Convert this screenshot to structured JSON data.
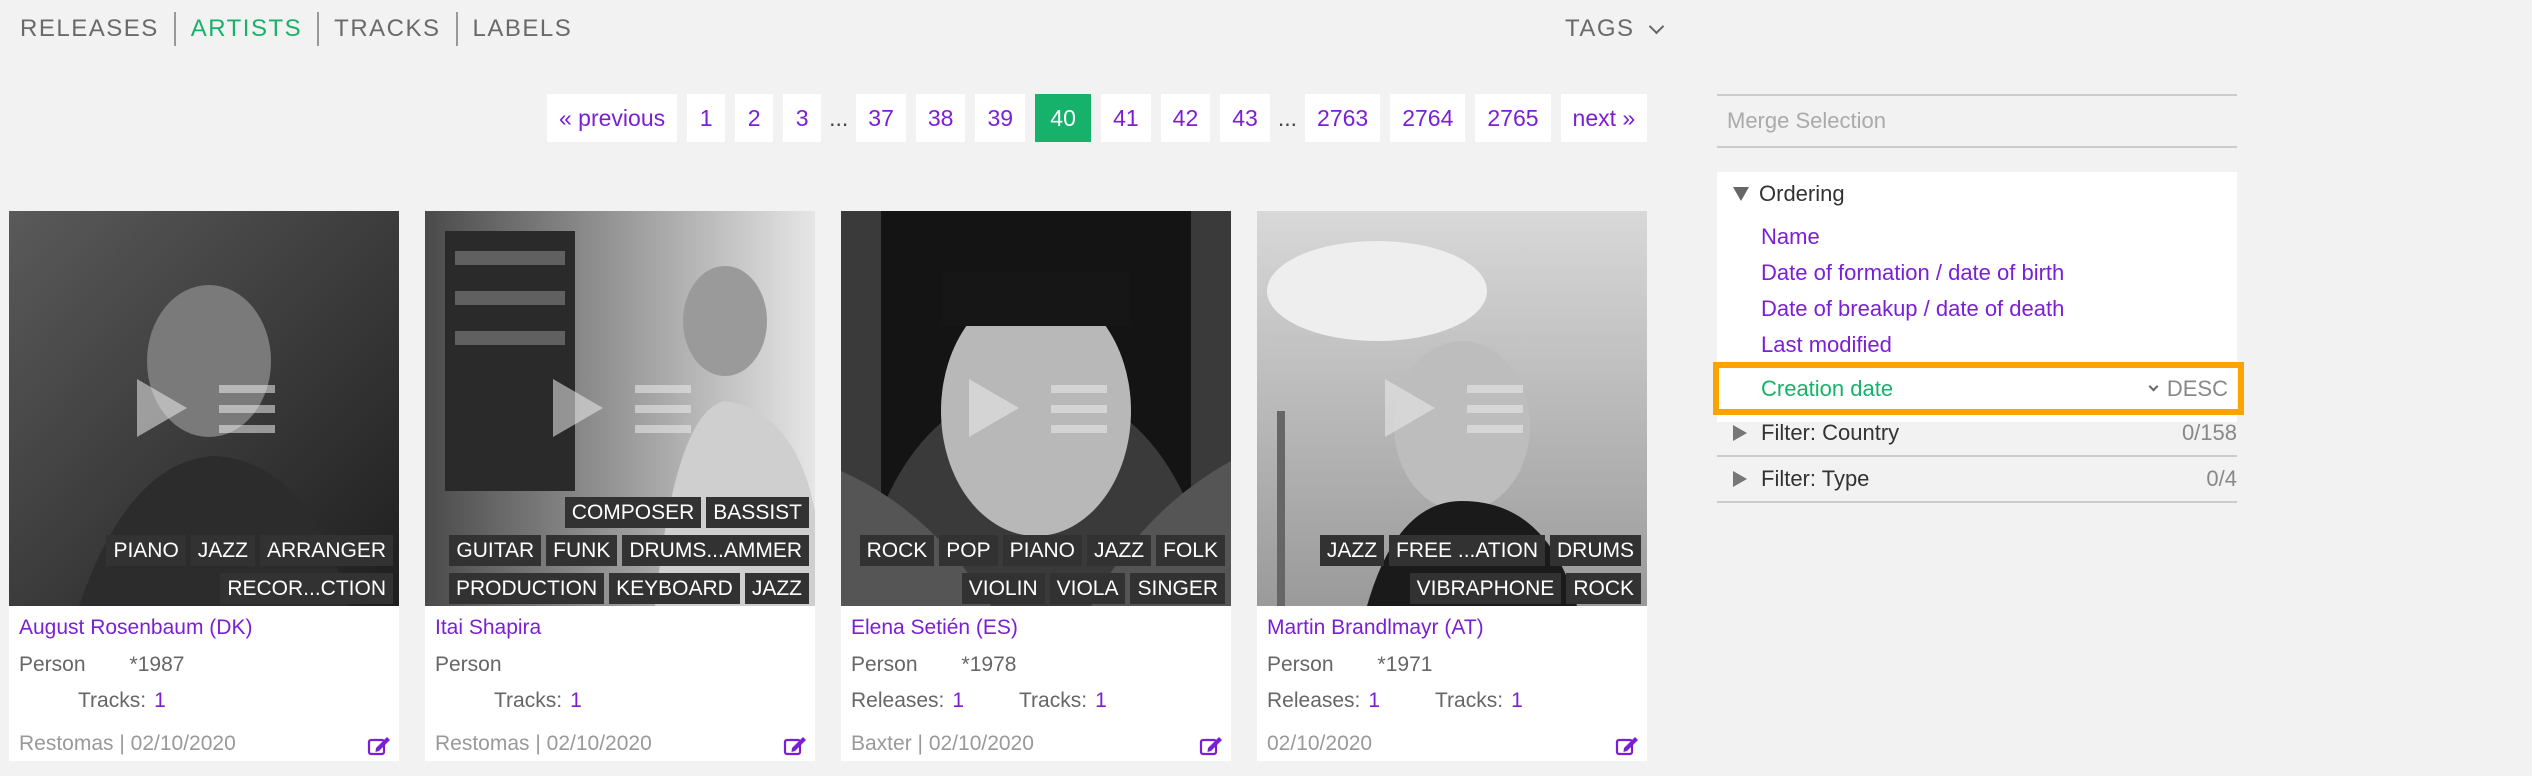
{
  "nav": {
    "tabs": [
      {
        "label": "RELEASES",
        "active": false
      },
      {
        "label": "ARTISTS",
        "active": true
      },
      {
        "label": "TRACKS",
        "active": false
      },
      {
        "label": "LABELS",
        "active": false
      }
    ],
    "tags_label": "TAGS"
  },
  "pagination": {
    "previous": "« previous",
    "next": "next »",
    "pages": [
      "1",
      "2",
      "3",
      "...",
      "37",
      "38",
      "39",
      "40",
      "41",
      "42",
      "43",
      "...",
      "2763",
      "2764",
      "2765"
    ],
    "current": "40"
  },
  "artists": [
    {
      "name": "August Rosenbaum (DK)",
      "type": "Person",
      "born": "*1987",
      "releases_label": "",
      "releases": "",
      "tracks_label": "Tracks:",
      "tracks": "1",
      "footer": "Restomas | 02/10/2020",
      "tag_rows": [
        [
          "PIANO",
          "JAZZ",
          "ARRANGER"
        ],
        [
          "RECOR...CTION"
        ]
      ]
    },
    {
      "name": "Itai Shapira",
      "type": "Person",
      "born": "",
      "releases_label": "",
      "releases": "",
      "tracks_label": "Tracks:",
      "tracks": "1",
      "footer": "Restomas | 02/10/2020",
      "tag_rows": [
        [
          "COMPOSER",
          "BASSIST"
        ],
        [
          "GUITAR",
          "FUNK",
          "DRUMS...AMMER"
        ],
        [
          "PRODUCTION",
          "KEYBOARD",
          "JAZZ"
        ]
      ]
    },
    {
      "name": "Elena Setién (ES)",
      "type": "Person",
      "born": "*1978",
      "releases_label": "Releases:",
      "releases": "1",
      "tracks_label": "Tracks:",
      "tracks": "1",
      "footer": "Baxter | 02/10/2020",
      "tag_rows": [
        [
          "ROCK",
          "POP",
          "PIANO",
          "JAZZ",
          "FOLK"
        ],
        [
          "VIOLIN",
          "VIOLA",
          "SINGER"
        ]
      ]
    },
    {
      "name": "Martin Brandlmayr (AT)",
      "type": "Person",
      "born": "*1971",
      "releases_label": "Releases:",
      "releases": "1",
      "tracks_label": "Tracks:",
      "tracks": "1",
      "footer": "02/10/2020",
      "tag_rows": [
        [
          "JAZZ",
          "FREE ...ATION",
          "DRUMS"
        ],
        [
          "VIBRAPHONE",
          "ROCK"
        ]
      ]
    }
  ],
  "sidebar": {
    "merge_placeholder": "Merge Selection",
    "ordering": {
      "title": "Ordering",
      "options": [
        "Name",
        "Date of formation / date of birth",
        "Date of breakup / date of death",
        "Last modified"
      ],
      "selected": "Creation date",
      "direction": "DESC"
    },
    "filters": [
      {
        "label": "Filter: Country",
        "count": "0/158"
      },
      {
        "label": "Filter: Type",
        "count": "0/4"
      }
    ]
  },
  "colors": {
    "accent_green": "#16b16b",
    "link_purple": "#7b1fd6",
    "highlight_orange": "#fba400"
  }
}
